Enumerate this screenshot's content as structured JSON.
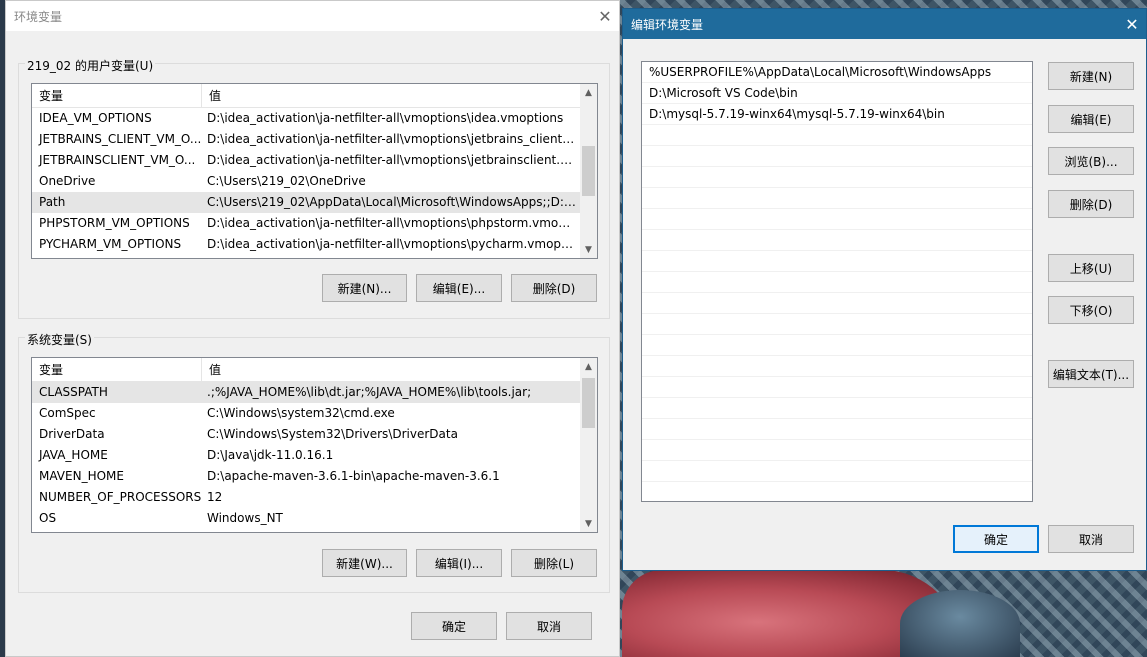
{
  "left_dialog": {
    "title": "环境变量",
    "user_group_label": "219_02 的用户变量(U)",
    "user_table": {
      "headers": [
        "变量",
        "值"
      ],
      "rows": [
        {
          "name": "IDEA_VM_OPTIONS",
          "value": "D:\\idea_activation\\ja-netfilter-all\\vmoptions\\idea.vmoptions"
        },
        {
          "name": "JETBRAINS_CLIENT_VM_O...",
          "value": "D:\\idea_activation\\ja-netfilter-all\\vmoptions\\jetbrains_client.v..."
        },
        {
          "name": "JETBRAINSCLIENT_VM_O...",
          "value": "D:\\idea_activation\\ja-netfilter-all\\vmoptions\\jetbrainsclient.vm..."
        },
        {
          "name": "OneDrive",
          "value": "C:\\Users\\219_02\\OneDrive"
        },
        {
          "name": "Path",
          "value": "C:\\Users\\219_02\\AppData\\Local\\Microsoft\\WindowsApps;;D:\\..."
        },
        {
          "name": "PHPSTORM_VM_OPTIONS",
          "value": "D:\\idea_activation\\ja-netfilter-all\\vmoptions\\phpstorm.vmopti..."
        },
        {
          "name": "PYCHARM_VM_OPTIONS",
          "value": "D:\\idea_activation\\ja-netfilter-all\\vmoptions\\pycharm.vmoptio..."
        }
      ]
    },
    "user_buttons": {
      "new": "新建(N)...",
      "edit": "编辑(E)...",
      "delete": "删除(D)"
    },
    "system_group_label": "系统变量(S)",
    "system_table": {
      "headers": [
        "变量",
        "值"
      ],
      "rows": [
        {
          "name": "CLASSPATH",
          "value": ".;%JAVA_HOME%\\lib\\dt.jar;%JAVA_HOME%\\lib\\tools.jar;"
        },
        {
          "name": "ComSpec",
          "value": "C:\\Windows\\system32\\cmd.exe"
        },
        {
          "name": "DriverData",
          "value": "C:\\Windows\\System32\\Drivers\\DriverData"
        },
        {
          "name": "JAVA_HOME",
          "value": "D:\\Java\\jdk-11.0.16.1"
        },
        {
          "name": "MAVEN_HOME",
          "value": "D:\\apache-maven-3.6.1-bin\\apache-maven-3.6.1"
        },
        {
          "name": "NUMBER_OF_PROCESSORS",
          "value": "12"
        },
        {
          "name": "OS",
          "value": "Windows_NT"
        }
      ]
    },
    "system_buttons": {
      "new": "新建(W)...",
      "edit": "编辑(I)...",
      "delete": "删除(L)"
    },
    "ok": "确定",
    "cancel": "取消"
  },
  "right_dialog": {
    "title": "编辑环境变量",
    "paths": [
      "%USERPROFILE%\\AppData\\Local\\Microsoft\\WindowsApps",
      "D:\\Microsoft VS Code\\bin",
      "D:\\mysql-5.7.19-winx64\\mysql-5.7.19-winx64\\bin"
    ],
    "buttons": {
      "new": "新建(N)",
      "edit": "编辑(E)",
      "browse": "浏览(B)...",
      "delete": "删除(D)",
      "move_up": "上移(U)",
      "move_down": "下移(O)",
      "edit_text": "编辑文本(T)..."
    },
    "ok": "确定",
    "cancel": "取消"
  },
  "colors": {
    "accent": "#0078d7",
    "title_bar": "#1f6b9c",
    "selection": "#e5e5e5"
  }
}
